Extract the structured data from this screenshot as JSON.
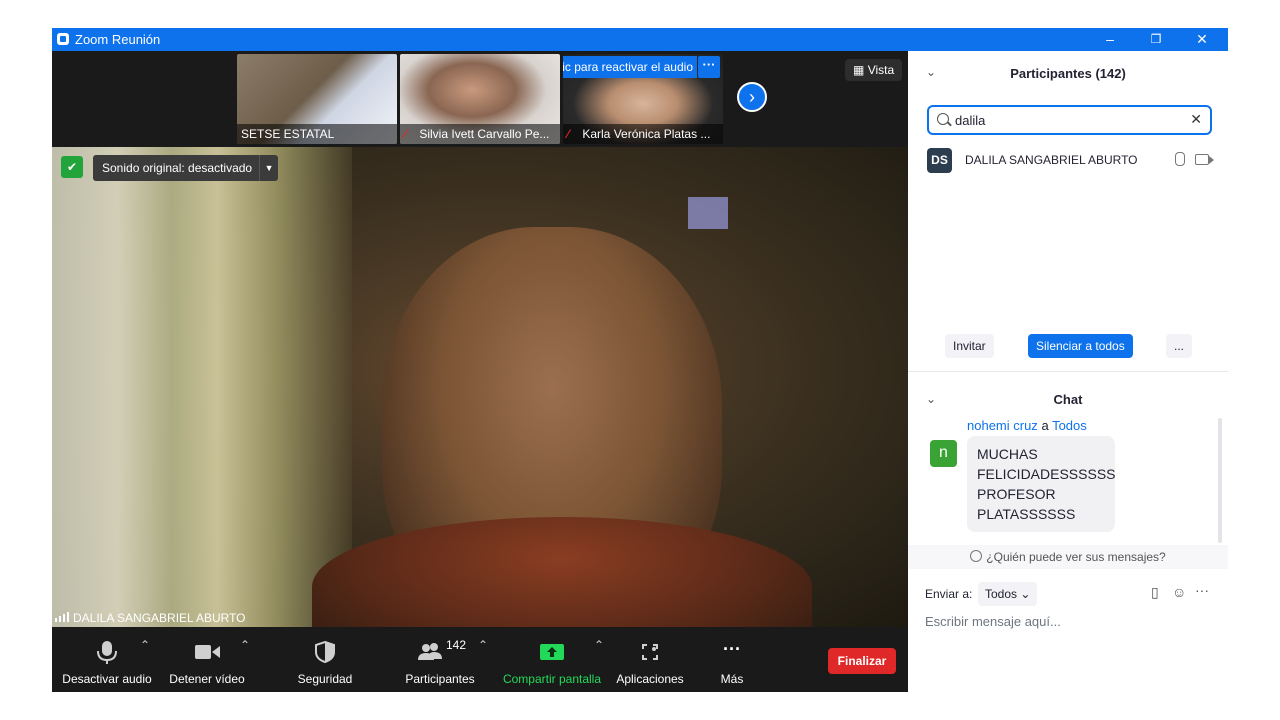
{
  "window": {
    "title": "Zoom Reunión",
    "minimize": "–",
    "restore": "❐",
    "close": "✕"
  },
  "strip": {
    "thumbs": [
      {
        "name": "SETSE ESTATAL",
        "muted": false
      },
      {
        "name": "Silvia Ivett Carvallo Pe...",
        "muted": true
      },
      {
        "name": "Karla Verónica Platas ...",
        "muted": true
      }
    ],
    "reactivate_label": "Haz clic para reactivar el audio",
    "more_label": "···",
    "next_label": "›",
    "view_label": "Vista"
  },
  "video": {
    "sound_label": "Sonido original: desactivado",
    "speaker_name": "DALILA SANGABRIEL ABURTO"
  },
  "toolbar": {
    "audio_label": "Desactivar audio",
    "video_label": "Detener vídeo",
    "security_label": "Seguridad",
    "participants_label": "Participantes",
    "participants_count": "142",
    "share_label": "Compartir pantalla",
    "apps_label": "Aplicaciones",
    "more_label": "Más",
    "more_dots": "···",
    "end_label": "Finalizar"
  },
  "participants": {
    "title": "Participantes (142)",
    "search_value": "dalila",
    "list": [
      {
        "initials": "DS",
        "name": "DALILA SANGABRIEL ABURTO"
      }
    ],
    "invite_label": "Invitar",
    "mute_all_label": "Silenciar a todos",
    "more_label": "..."
  },
  "chat": {
    "title": "Chat",
    "message": {
      "sender": "nohemi cruz",
      "connector": "a",
      "recipient": "Todos",
      "avatar": "n",
      "text_lines": [
        "MUCHAS",
        "FELICIDADESSSSSS",
        "PROFESOR",
        "PLATASSSSSS"
      ]
    },
    "who_can_see": "¿Quién puede ver sus mensajes?",
    "send_to_label": "Enviar a:",
    "send_to_value": "Todos",
    "compose_placeholder": "Escribir mensaje aquí..."
  },
  "colors": {
    "accent": "#0e72ed",
    "danger": "#e02828",
    "share": "#23d959",
    "dark": "#1a1a1a"
  }
}
